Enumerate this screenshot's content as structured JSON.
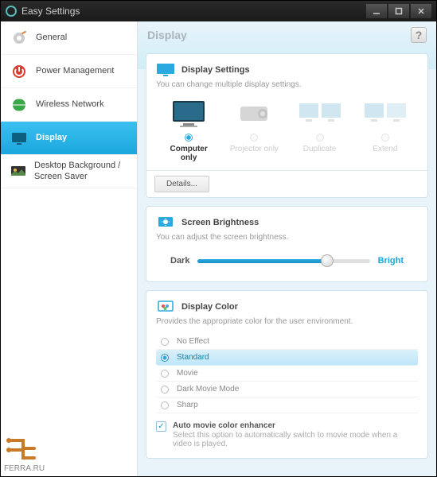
{
  "window": {
    "title": "Easy Settings"
  },
  "sidebar": {
    "items": [
      {
        "label": "General"
      },
      {
        "label": "Power Management"
      },
      {
        "label": "Wireless Network"
      },
      {
        "label": "Display"
      },
      {
        "label": "Desktop Background / Screen Saver"
      }
    ],
    "selected_index": 3
  },
  "main": {
    "heading": "Display",
    "help_label": "?",
    "display_settings": {
      "title": "Display Settings",
      "subtitle": "You can change multiple display settings.",
      "options": [
        {
          "label": "Computer only",
          "selected": true
        },
        {
          "label": "Projector only",
          "selected": false
        },
        {
          "label": "Duplicate",
          "selected": false
        },
        {
          "label": "Extend",
          "selected": false
        }
      ],
      "details_label": "Details..."
    },
    "brightness": {
      "title": "Screen Brightness",
      "subtitle": "You can adjust the screen brightness.",
      "min_label": "Dark",
      "max_label": "Bright",
      "value_percent": 75
    },
    "display_color": {
      "title": "Display Color",
      "subtitle": "Provides the appropriate color for the user environment.",
      "options": [
        {
          "label": "No Effect"
        },
        {
          "label": "Standard"
        },
        {
          "label": "Movie"
        },
        {
          "label": "Dark Movie Mode"
        },
        {
          "label": "Sharp"
        }
      ],
      "selected_index": 1,
      "auto_enhance": {
        "checked": true,
        "title": "Auto movie color enhancer",
        "desc": "Select this option to automatically switch to movie mode when a video is played."
      }
    }
  },
  "watermark": "FERRA.RU"
}
